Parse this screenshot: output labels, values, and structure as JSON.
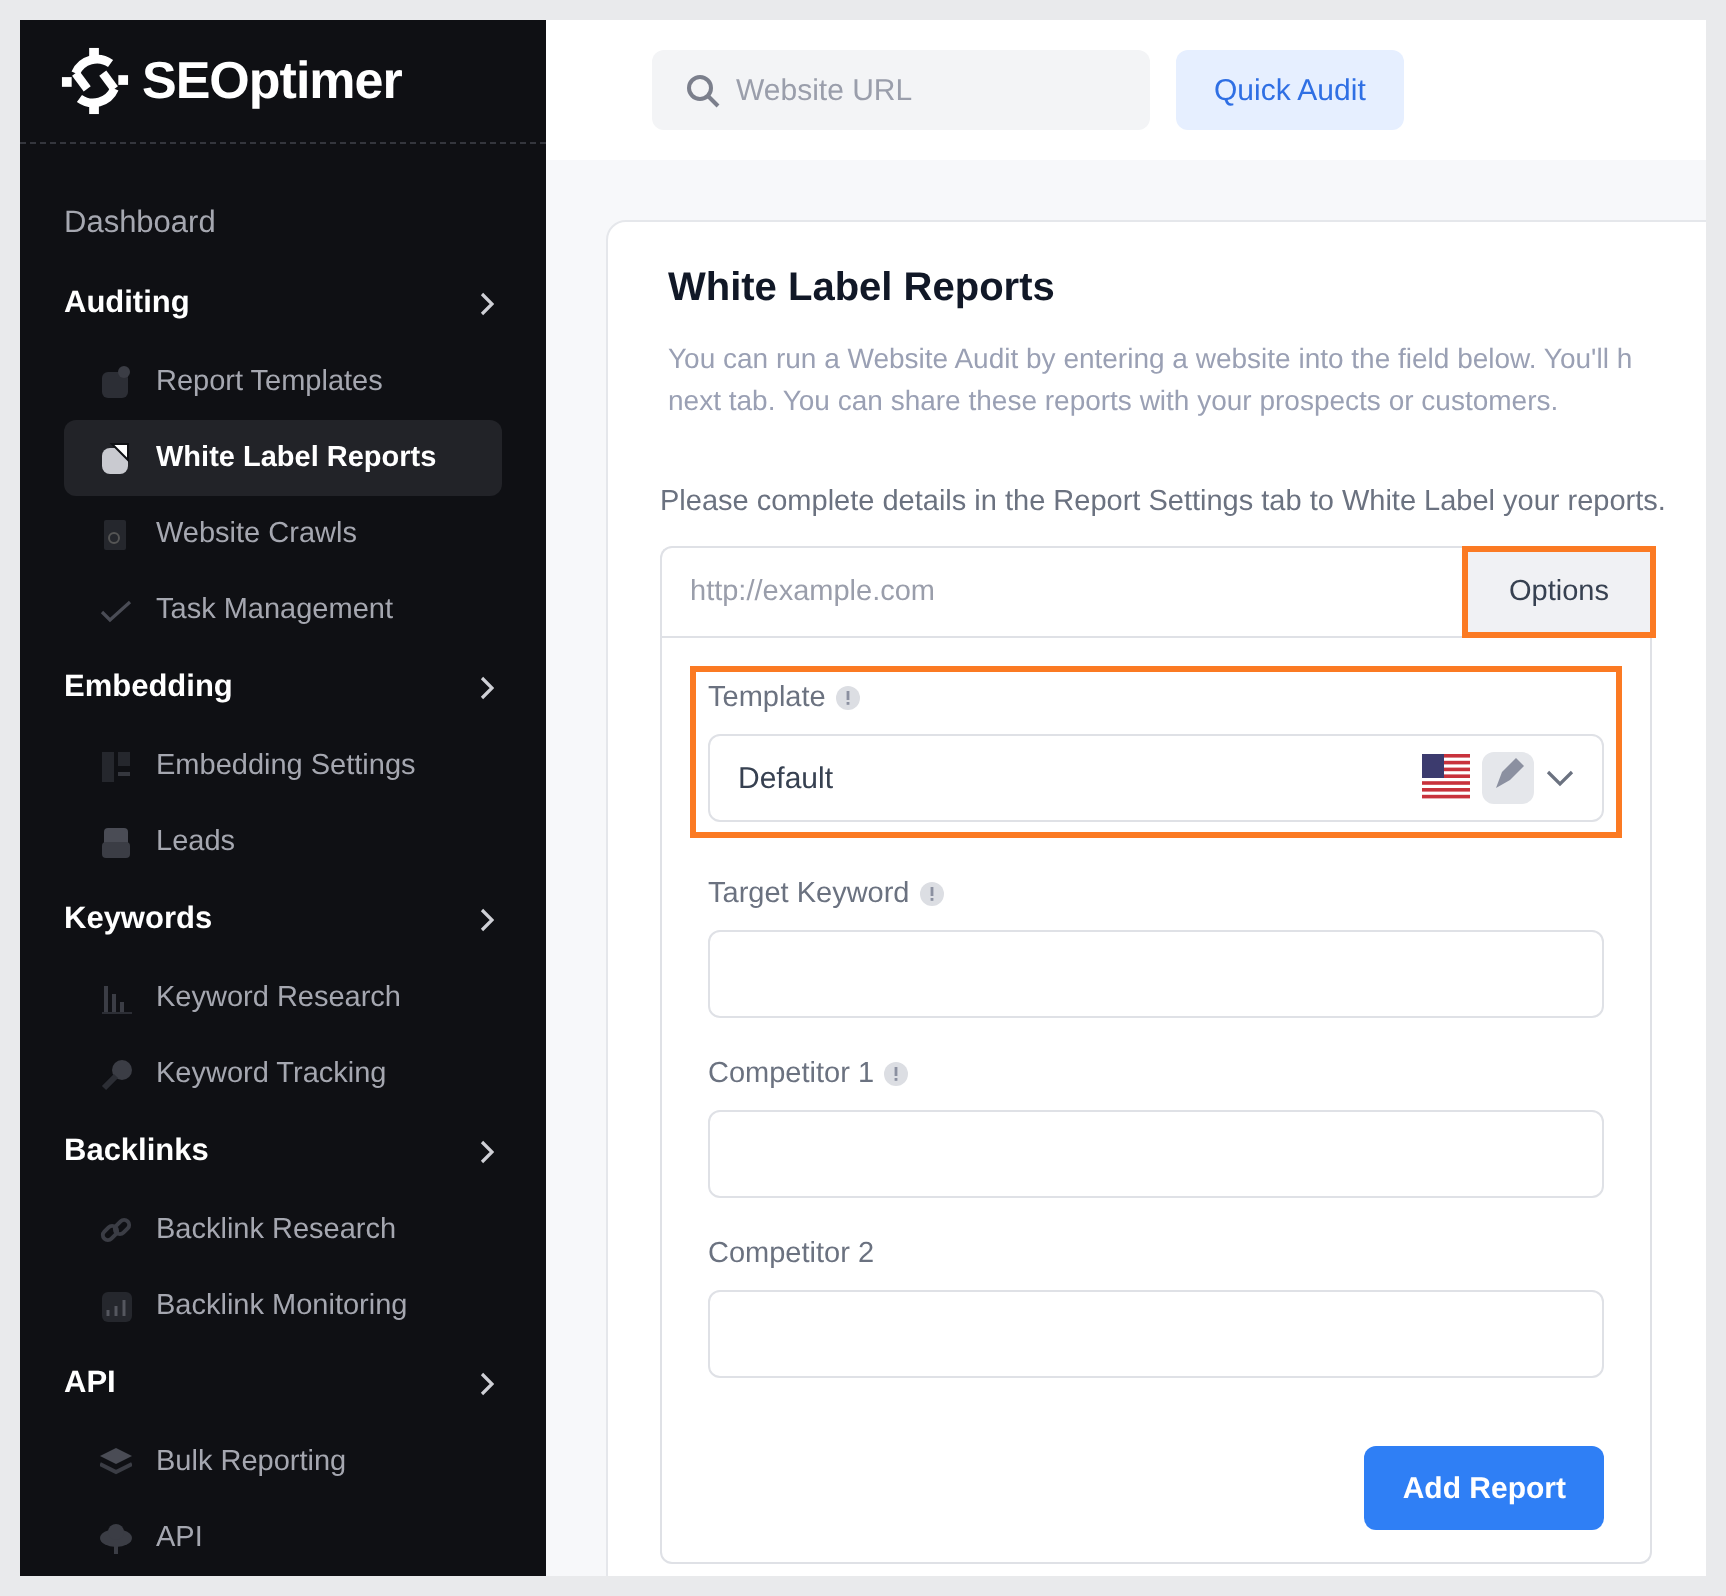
{
  "brand": {
    "name": "SEOptimer"
  },
  "sidebar": {
    "items": [
      {
        "kind": "link",
        "label": "Dashboard",
        "selected": false
      },
      {
        "kind": "section",
        "label": "Auditing",
        "selected": false
      },
      {
        "kind": "item",
        "label": "Report Templates",
        "selected": false
      },
      {
        "kind": "item",
        "label": "White Label Reports",
        "selected": true
      },
      {
        "kind": "item",
        "label": "Website Crawls",
        "selected": false
      },
      {
        "kind": "item",
        "label": "Task Management",
        "selected": false
      },
      {
        "kind": "section",
        "label": "Embedding",
        "selected": false
      },
      {
        "kind": "item",
        "label": "Embedding Settings",
        "selected": false
      },
      {
        "kind": "item",
        "label": "Leads",
        "selected": false
      },
      {
        "kind": "section",
        "label": "Keywords",
        "selected": false
      },
      {
        "kind": "item",
        "label": "Keyword Research",
        "selected": false
      },
      {
        "kind": "item",
        "label": "Keyword Tracking",
        "selected": false
      },
      {
        "kind": "section",
        "label": "Backlinks",
        "selected": false
      },
      {
        "kind": "item",
        "label": "Backlink Research",
        "selected": false
      },
      {
        "kind": "item",
        "label": "Backlink Monitoring",
        "selected": false
      },
      {
        "kind": "section",
        "label": "API",
        "selected": false
      },
      {
        "kind": "item",
        "label": "Bulk Reporting",
        "selected": false
      },
      {
        "kind": "item",
        "label": "API",
        "selected": false
      }
    ]
  },
  "topbar": {
    "search": {
      "placeholder": "Website URL"
    },
    "button": "Quick Audit"
  },
  "card": {
    "title": "White Label Reports",
    "description": [
      "You can run a Website Audit by entering a website into the field below. You'll h",
      "next tab. You can share these reports with your prospects or customers."
    ],
    "note": "Please complete details in the Report Settings tab to White Label your reports.",
    "url": {
      "placeholder": "http://example.com"
    },
    "options_button": {
      "label": "Options",
      "highlighted": true
    },
    "template": {
      "label": "Template",
      "value": "Default",
      "highlighted": true
    },
    "fields": [
      {
        "label": "Target Keyword",
        "info": true
      },
      {
        "label": "Competitor 1",
        "info": true
      },
      {
        "label": "Competitor 2",
        "info": false
      }
    ],
    "submit": "Add Report"
  }
}
